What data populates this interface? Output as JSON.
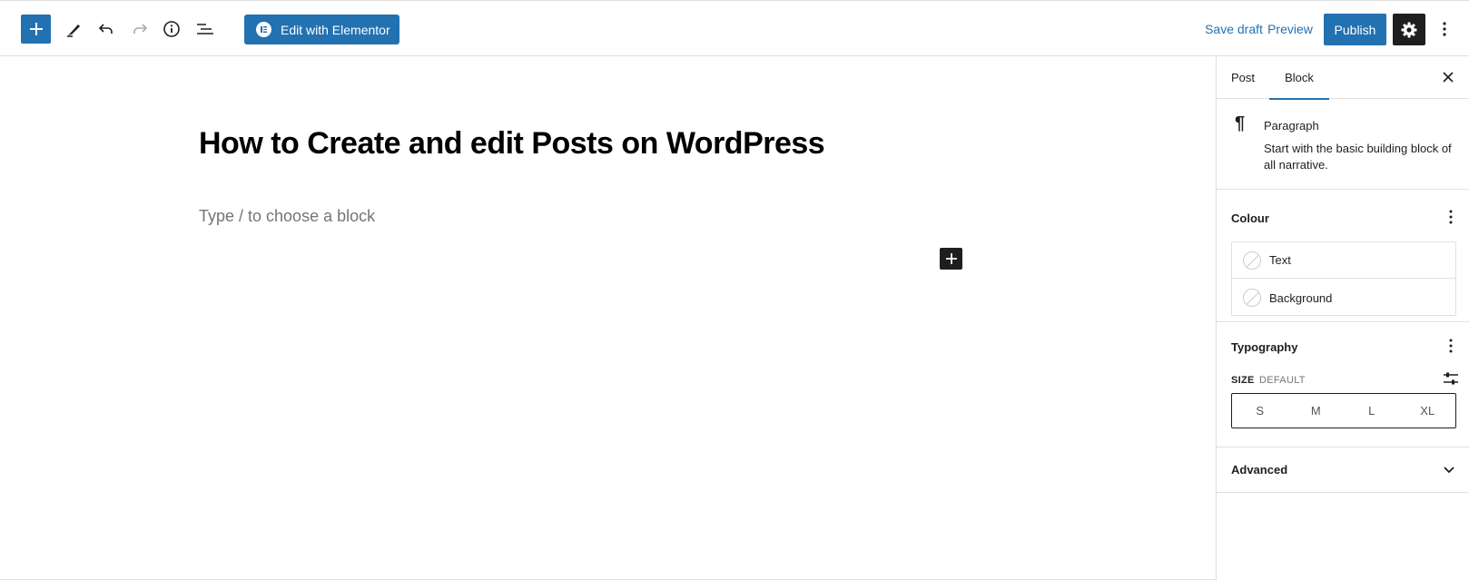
{
  "toolbar": {
    "edit_with_elementor": "Edit with Elementor",
    "save_draft": "Save draft",
    "preview": "Preview",
    "publish": "Publish"
  },
  "editor": {
    "post_title": "How to Create and edit Posts on WordPress",
    "block_placeholder": "Type / to choose a block"
  },
  "sidebar": {
    "tabs": [
      {
        "label": "Post",
        "active": false
      },
      {
        "label": "Block",
        "active": true
      }
    ],
    "block_card": {
      "title": "Paragraph",
      "description": "Start with the basic building block of all narrative."
    },
    "colour": {
      "title": "Colour",
      "items": [
        "Text",
        "Background"
      ]
    },
    "typography": {
      "title": "Typography",
      "size_label": "SIZE",
      "size_value": "DEFAULT",
      "size_options": [
        "S",
        "M",
        "L",
        "XL"
      ]
    },
    "advanced": {
      "title": "Advanced"
    }
  },
  "colors": {
    "accent": "#2271b1",
    "dark": "#1e1e1e",
    "muted": "#757575",
    "border": "#e0e0e0"
  }
}
